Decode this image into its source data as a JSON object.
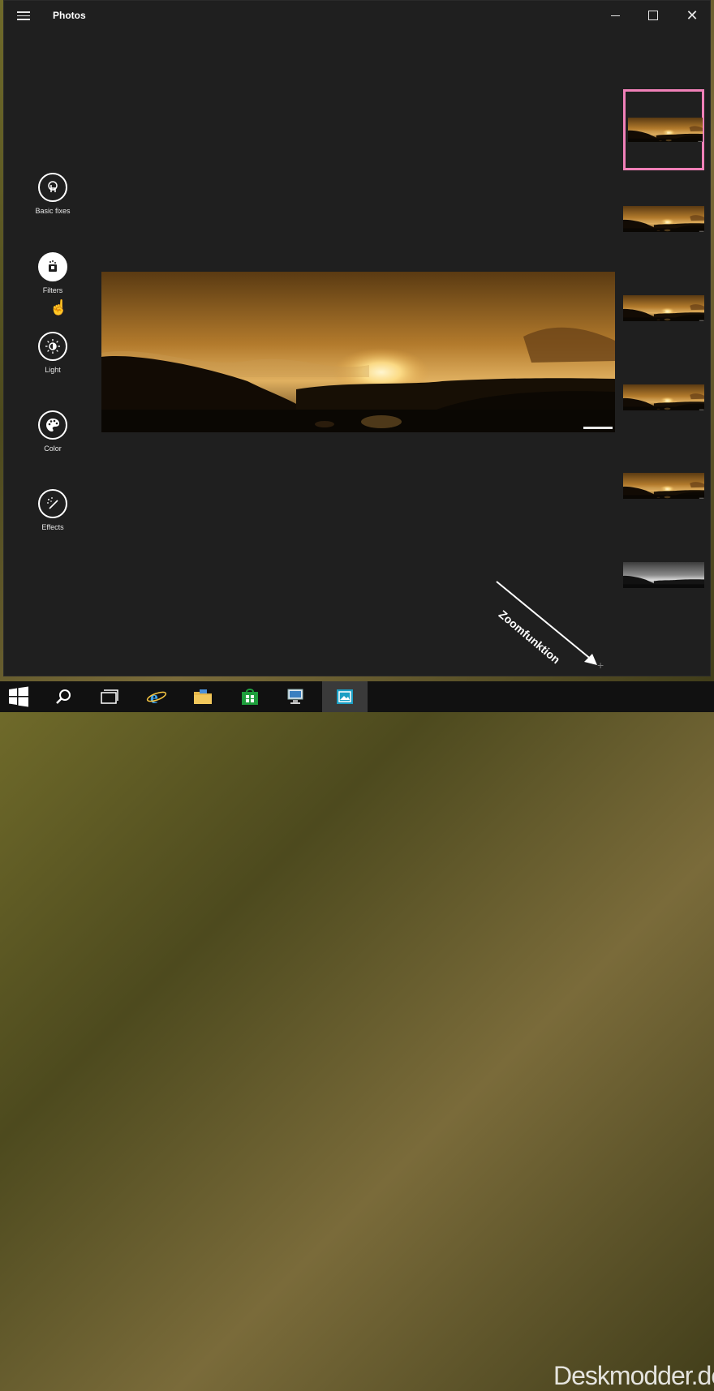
{
  "window": {
    "title": "Photos",
    "controls": {
      "minimize": "minimize-icon",
      "maximize": "maximize-icon",
      "close": "close-icon"
    }
  },
  "tools": [
    {
      "label": "Basic fixes",
      "icon": "basic-fixes-icon",
      "active": false
    },
    {
      "label": "Filters",
      "icon": "filters-icon",
      "active": true
    },
    {
      "label": "Light",
      "icon": "light-icon",
      "active": false
    },
    {
      "label": "Color",
      "icon": "color-palette-icon",
      "active": false
    },
    {
      "label": "Effects",
      "icon": "effects-wand-icon",
      "active": false
    }
  ],
  "filters": {
    "count": 6,
    "selected_index": 0,
    "last_is_grayscale": true
  },
  "annotation": {
    "label": "Zoomfunktion",
    "plus": "+"
  },
  "taskbar": {
    "items": [
      "start-icon",
      "search-icon",
      "task-view-icon",
      "internet-explorer-icon",
      "file-explorer-icon",
      "store-icon",
      "network-computer-icon",
      "photos-icon"
    ],
    "active_index": 7
  },
  "watermark": "Deskmodder.de",
  "colors": {
    "window_bg": "#1f1f1f",
    "selection_border": "#f080b8",
    "taskbar_bg": "#111111"
  }
}
